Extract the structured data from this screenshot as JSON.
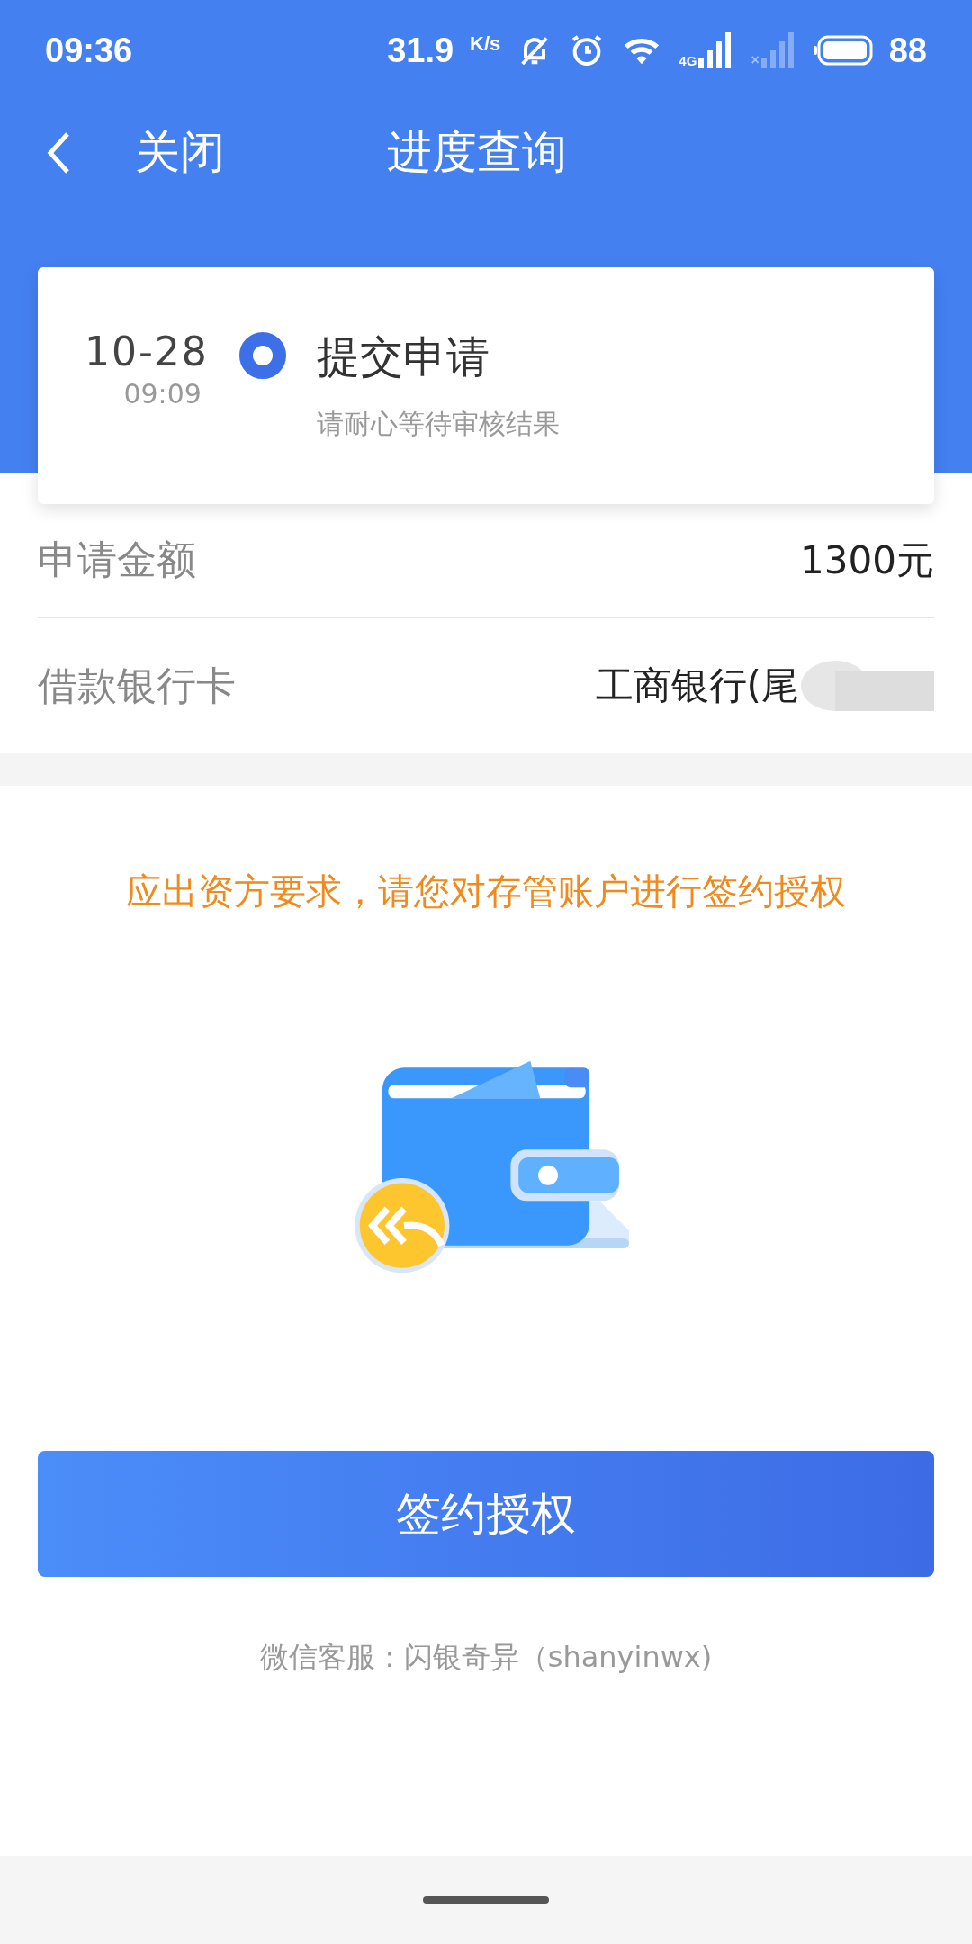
{
  "status_bar": {
    "time": "09:36",
    "speed": "31.9",
    "speed_unit": "K/s",
    "network": "4G",
    "sim2_mark": "×",
    "battery": "88"
  },
  "nav": {
    "back_label": "关闭",
    "title": "进度查询"
  },
  "progress": [
    {
      "date": "10-28",
      "time": "09:09",
      "title": "提交申请",
      "note": "请耐心等待审核结果",
      "selected": true
    }
  ],
  "details": [
    {
      "label": "申请金额",
      "value": "1300元",
      "redacted": false
    },
    {
      "label": "借款银行卡",
      "value": "工商银行(尾",
      "redacted": true
    }
  ],
  "notice": "应出资方要求，请您对存管账户进行签约授权",
  "button": "签约授权",
  "footer": "微信客服：闪银奇异（shanyinwx)"
}
